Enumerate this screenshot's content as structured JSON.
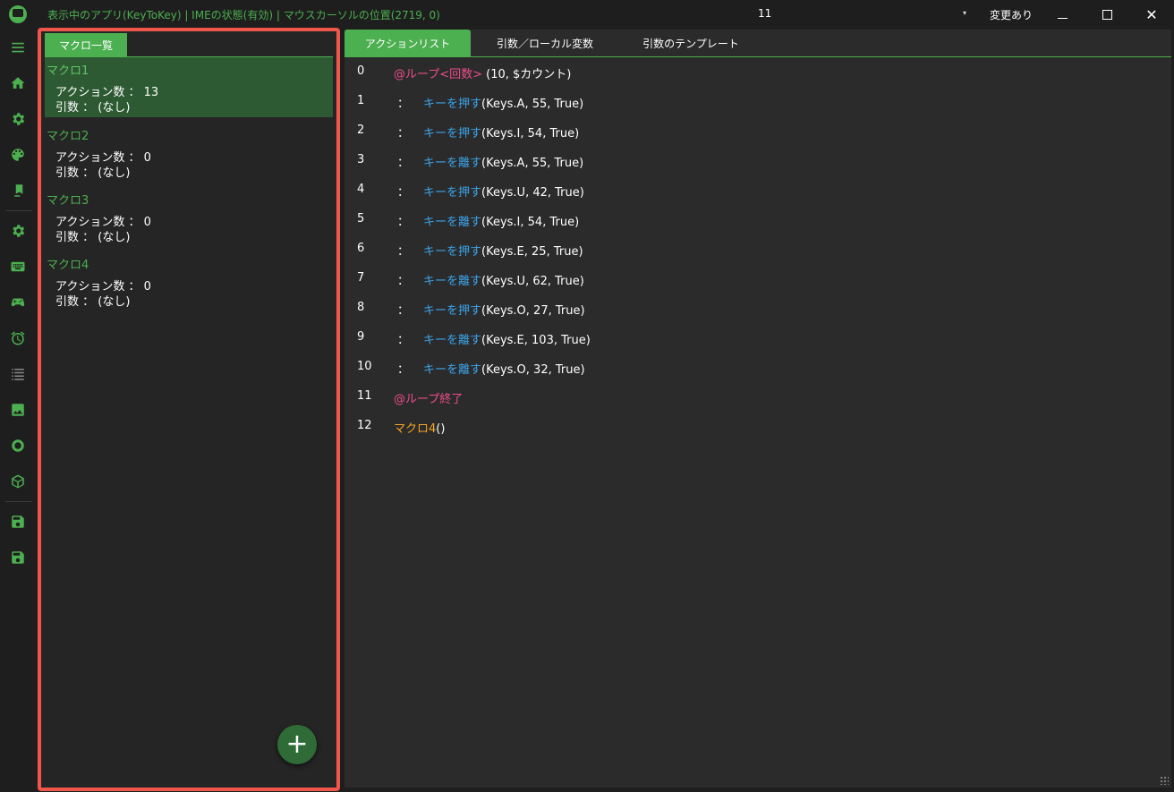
{
  "titlebar": {
    "status": "表示中のアプリ(KeyToKey)  |  IMEの状態(有効)  |  マウスカーソルの位置(2719, 0)",
    "center_number": "11",
    "dropdown_arrow": "▾",
    "changed_label": "変更あり"
  },
  "sidebar": {
    "icons": [
      "menu-icon",
      "home-icon",
      "gear-icon",
      "palette-icon",
      "bookmark-icon",
      "gear-icon",
      "keyboard-icon",
      "gamepad-icon",
      "alarm-icon",
      "list-icon",
      "image-icon",
      "circle-icon",
      "cube-icon",
      "save-icon",
      "save-icon"
    ]
  },
  "macro_panel": {
    "tab_label": "マクロ一覧",
    "accent_border": "#f0574a",
    "macros": [
      {
        "name": "マクロ1",
        "action_count": "アクション数 ： 13",
        "args": "引数 ： (なし)",
        "selected": true
      },
      {
        "name": "マクロ2",
        "action_count": "アクション数 ： 0",
        "args": "引数 ： (なし)",
        "selected": false
      },
      {
        "name": "マクロ3",
        "action_count": "アクション数 ： 0",
        "args": "引数 ： (なし)",
        "selected": false
      },
      {
        "name": "マクロ4",
        "action_count": "アクション数 ： 0",
        "args": "引数 ： (なし)",
        "selected": false
      }
    ],
    "add_button_label": "+"
  },
  "editor": {
    "tabs": [
      {
        "label": "アクションリスト",
        "active": true
      },
      {
        "label": "引数／ローカル変数",
        "active": false
      },
      {
        "label": "引数のテンプレート",
        "active": false
      }
    ],
    "rows": [
      {
        "num": "0",
        "colon": "",
        "keyword": "@ループ<回数>",
        "keyword_color": "pink",
        "args": " (10, $カウント)"
      },
      {
        "num": "1",
        "colon": "：",
        "keyword": "キーを押す",
        "keyword_color": "blue",
        "args": "(Keys.A, 55, True)"
      },
      {
        "num": "2",
        "colon": "：",
        "keyword": "キーを押す",
        "keyword_color": "blue",
        "args": "(Keys.I, 54, True)"
      },
      {
        "num": "3",
        "colon": "：",
        "keyword": "キーを離す",
        "keyword_color": "blue",
        "args": "(Keys.A, 55, True)"
      },
      {
        "num": "4",
        "colon": "：",
        "keyword": "キーを押す",
        "keyword_color": "blue",
        "args": "(Keys.U, 42, True)"
      },
      {
        "num": "5",
        "colon": "：",
        "keyword": "キーを離す",
        "keyword_color": "blue",
        "args": "(Keys.I, 54, True)"
      },
      {
        "num": "6",
        "colon": "：",
        "keyword": "キーを押す",
        "keyword_color": "blue",
        "args": "(Keys.E, 25, True)"
      },
      {
        "num": "7",
        "colon": "：",
        "keyword": "キーを離す",
        "keyword_color": "blue",
        "args": "(Keys.U, 62, True)"
      },
      {
        "num": "8",
        "colon": "：",
        "keyword": "キーを押す",
        "keyword_color": "blue",
        "args": "(Keys.O, 27, True)"
      },
      {
        "num": "9",
        "colon": "：",
        "keyword": "キーを離す",
        "keyword_color": "blue",
        "args": "(Keys.E, 103, True)"
      },
      {
        "num": "10",
        "colon": "：",
        "keyword": "キーを離す",
        "keyword_color": "blue",
        "args": "(Keys.O, 32, True)"
      },
      {
        "num": "11",
        "colon": "",
        "keyword": "@ループ終了",
        "keyword_color": "pink",
        "args": ""
      },
      {
        "num": "12",
        "colon": "",
        "keyword": "マクロ4",
        "keyword_color": "orange",
        "args": "()"
      }
    ]
  },
  "colors": {
    "accent": "#4caf50",
    "pink": "#ec4d8b",
    "blue": "#3ba4ea",
    "orange": "#f5a524"
  }
}
